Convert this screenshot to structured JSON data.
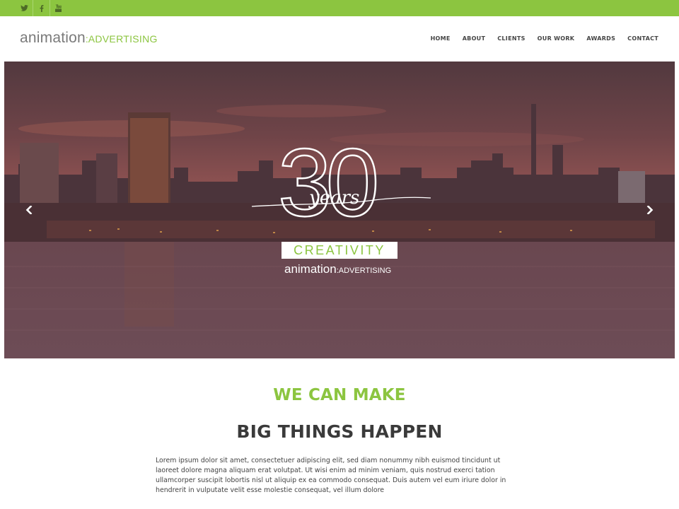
{
  "social": {
    "icons": [
      "twitter-icon",
      "facebook-icon",
      "youtube-icon"
    ]
  },
  "brand": {
    "name": "animation",
    "separator": ":",
    "suffix": "ADVERTISING",
    "accent_color": "#8cc540"
  },
  "nav": {
    "items": [
      "HOME",
      "ABOUT",
      "CLIENTS",
      "OUR WORK",
      "AWARDS",
      "CONTACT"
    ]
  },
  "hero": {
    "number": "30",
    "script": "years",
    "creativity": "CREATIVITY",
    "brand_name": "animation",
    "brand_separator": ":",
    "brand_suffix": "ADVERTISING",
    "prev_icon": "chevron-left-icon",
    "next_icon": "chevron-right-icon"
  },
  "content": {
    "heading_accent": "WE CAN MAKE",
    "heading_main": "BIG THINGS HAPPEN",
    "paragraph": "Lorem ipsum dolor sit amet, consectetuer adipiscing elit, sed diam nonummy nibh euismod tincidunt ut laoreet dolore magna aliquam erat volutpat. Ut wisi enim ad minim veniam, quis nostrud exerci tation ullamcorper suscipit lobortis nisl ut aliquip ex ea commodo consequat. Duis autem vel eum iriure dolor in hendrerit in vulputate velit esse molestie consequat, vel illum dolore"
  }
}
